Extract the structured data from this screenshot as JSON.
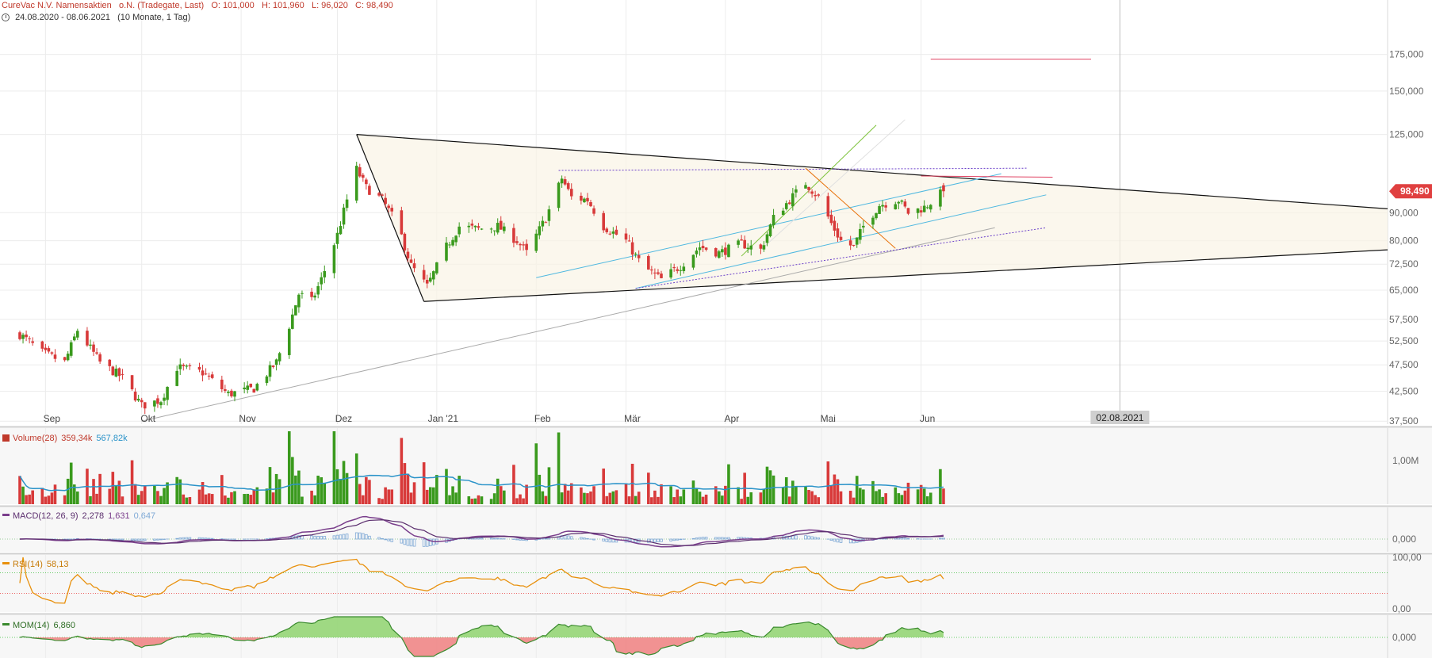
{
  "header": {
    "title_parts": [
      "CureVac N.V. Namensaktien",
      "o.N. (Tradegate, Last)",
      "O: 101,000",
      "H: 101,960",
      "L: 96,020",
      "C: 98,490"
    ],
    "range_parts": [
      "24.08.2020 - 08.06.2021",
      "(10 Monate, 1 Tag)"
    ]
  },
  "colors": {
    "up": "#3a9a1d",
    "down": "#d83a3a",
    "grid": "#ececec",
    "ma_blue": "#2a93c9",
    "macd": "#7a3e8c",
    "signal": "#5b2e6e",
    "rsi": "#e8900c",
    "mom": "#3a8a2e"
  },
  "chart_data": [
    {
      "type": "candlestick",
      "x_labels": [
        "Sep",
        "Okt",
        "Nov",
        "Dez",
        "Jan '21",
        "Feb",
        "Mär",
        "Apr",
        "Mai",
        "Jun"
      ],
      "y_ticks": [
        "37,500",
        "42,500",
        "47,500",
        "52,500",
        "57,500",
        "65,000",
        "72,500",
        "80,000",
        "90,000",
        "98,490",
        "125,000",
        "150,000",
        "175,000"
      ],
      "y_scale": "log",
      "ylim": [
        37.5,
        180
      ],
      "last_price": "98,490",
      "marker_label": "02.08.2021",
      "close_path": [
        [
          "2020-08-24",
          54
        ],
        [
          "2020-08-31",
          50
        ],
        [
          "2020-09-07",
          48
        ],
        [
          "2020-09-11",
          55
        ],
        [
          "2020-09-18",
          48
        ],
        [
          "2020-09-25",
          45
        ],
        [
          "2020-10-01",
          40
        ],
        [
          "2020-10-07",
          41
        ],
        [
          "2020-10-12",
          47
        ],
        [
          "2020-10-20",
          46
        ],
        [
          "2020-10-28",
          42
        ],
        [
          "2020-11-05",
          43
        ],
        [
          "2020-11-12",
          48
        ],
        [
          "2020-11-16",
          56
        ],
        [
          "2020-11-19",
          64
        ],
        [
          "2020-11-23",
          62
        ],
        [
          "2020-11-26",
          68
        ],
        [
          "2020-12-01",
          82
        ],
        [
          "2020-12-04",
          95
        ],
        [
          "2020-12-07",
          108
        ],
        [
          "2020-12-10",
          100
        ],
        [
          "2020-12-15",
          95
        ],
        [
          "2020-12-20",
          85
        ],
        [
          "2020-12-24",
          72
        ],
        [
          "2020-12-29",
          66
        ],
        [
          "2021-01-04",
          78
        ],
        [
          "2021-01-08",
          85
        ],
        [
          "2021-01-14",
          84
        ],
        [
          "2021-01-20",
          85
        ],
        [
          "2021-01-26",
          80
        ],
        [
          "2021-01-29",
          76
        ],
        [
          "2021-02-04",
          88
        ],
        [
          "2021-02-09",
          104
        ],
        [
          "2021-02-12",
          96
        ],
        [
          "2021-02-17",
          95
        ],
        [
          "2021-02-22",
          85
        ],
        [
          "2021-03-01",
          80
        ],
        [
          "2021-03-06",
          72
        ],
        [
          "2021-03-12",
          68
        ],
        [
          "2021-03-18",
          72
        ],
        [
          "2021-03-24",
          78
        ],
        [
          "2021-03-30",
          76
        ],
        [
          "2021-04-06",
          79
        ],
        [
          "2021-04-12",
          77
        ],
        [
          "2021-04-16",
          88
        ],
        [
          "2021-04-21",
          95
        ],
        [
          "2021-04-26",
          102
        ],
        [
          "2021-04-30",
          96
        ],
        [
          "2021-05-04",
          86
        ],
        [
          "2021-05-07",
          80
        ],
        [
          "2021-05-11",
          78
        ],
        [
          "2021-05-14",
          85
        ],
        [
          "2021-05-19",
          93
        ],
        [
          "2021-05-25",
          95
        ],
        [
          "2021-05-28",
          90
        ],
        [
          "2021-06-02",
          92
        ],
        [
          "2021-06-08",
          98.49
        ]
      ]
    },
    {
      "type": "bar",
      "name": "Volume(28)",
      "values_display": [
        "359,34k",
        "567,82k"
      ],
      "y_ticks": [
        "1,00M"
      ]
    },
    {
      "type": "line",
      "name": "MACD(12, 26, 9)",
      "values_display": [
        "2,278",
        "1,631",
        "0,647"
      ],
      "y_ticks": [
        "0,000"
      ]
    },
    {
      "type": "line",
      "name": "RSI(14)",
      "values_display": [
        "58,13"
      ],
      "y_ticks": [
        "100,00",
        "0,00"
      ]
    },
    {
      "type": "area",
      "name": "MOM(14)",
      "values_display": [
        "6,860"
      ],
      "y_ticks": [
        "0,000"
      ]
    }
  ]
}
